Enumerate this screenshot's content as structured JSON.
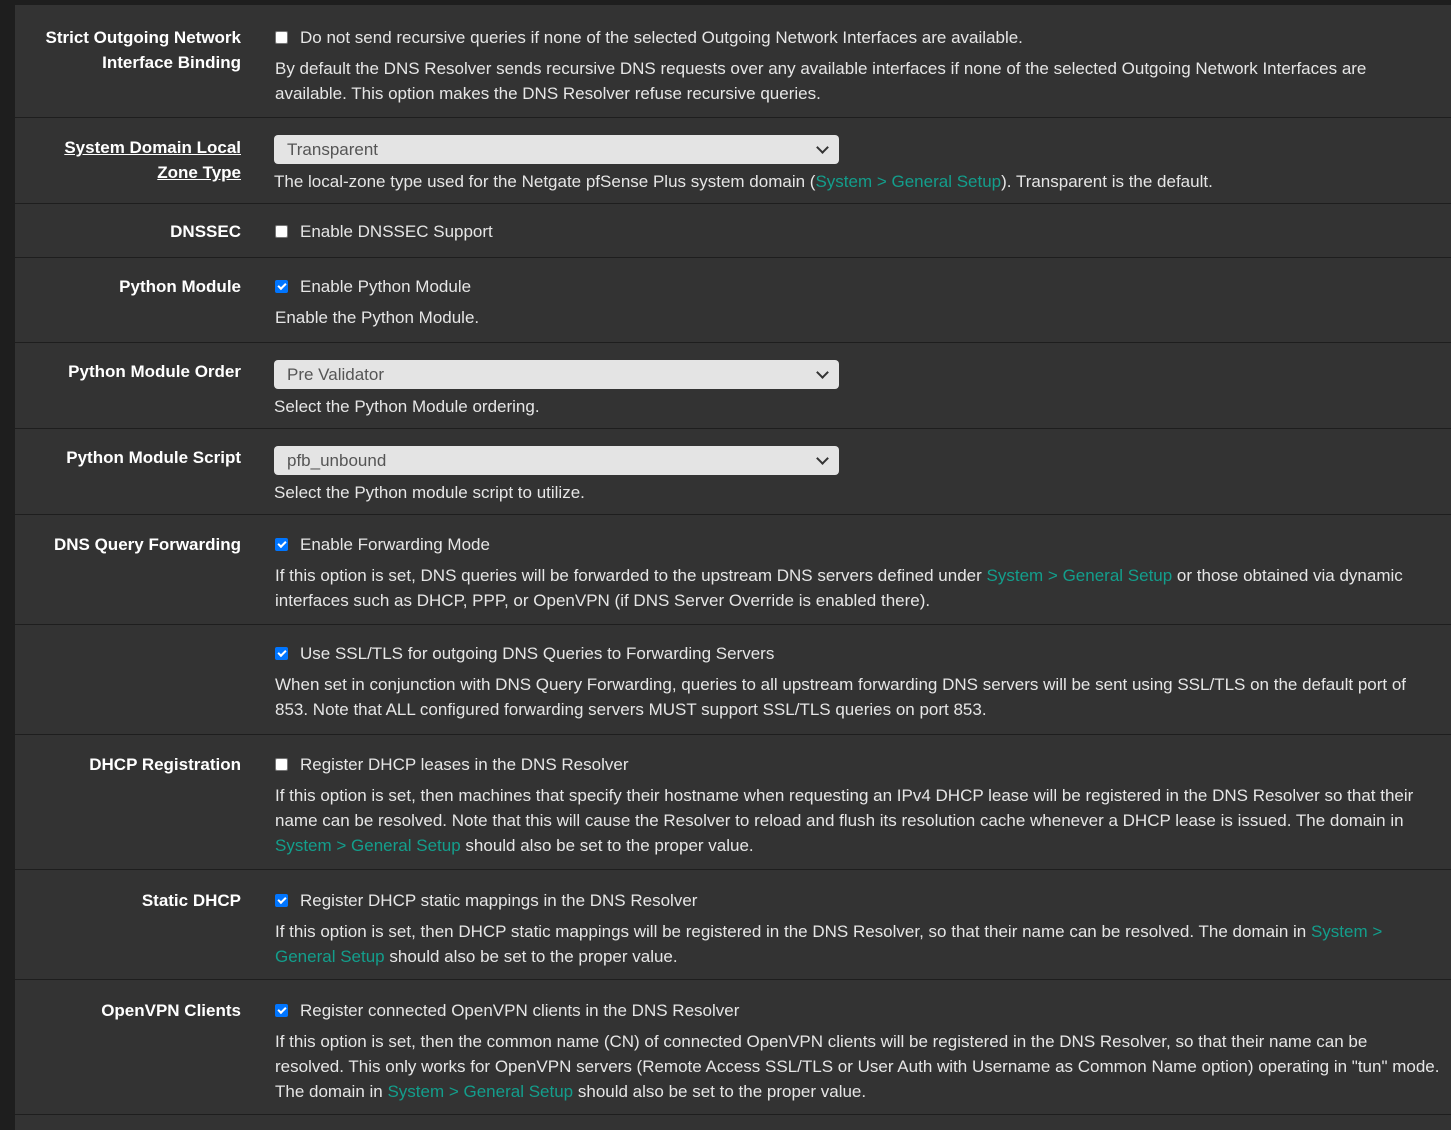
{
  "link_text": "System > General Setup",
  "rows": {
    "strict": {
      "label_line1": "Strict Outgoing Network",
      "label_line2": "Interface Binding",
      "checkbox_label": "Do not send recursive queries if none of the selected Outgoing Network Interfaces are available.",
      "checked": false,
      "desc": "By default the DNS Resolver sends recursive DNS requests over any available interfaces if none of the selected Outgoing Network Interfaces are available. This option makes the DNS Resolver refuse recursive queries."
    },
    "zone_type": {
      "label_line1": "System Domain Local",
      "label_line2": "Zone Type",
      "selected": "Transparent",
      "desc_before": "The local-zone type used for the Netgate pfSense Plus system domain (",
      "desc_after": "). Transparent is the default."
    },
    "dnssec": {
      "label": "DNSSEC",
      "checkbox_label": "Enable DNSSEC Support",
      "checked": false
    },
    "python_module": {
      "label": "Python Module",
      "checkbox_label": "Enable Python Module",
      "checked": true,
      "desc": "Enable the Python Module."
    },
    "python_order": {
      "label": "Python Module Order",
      "selected": "Pre Validator",
      "desc": "Select the Python Module ordering."
    },
    "python_script": {
      "label": "Python Module Script",
      "selected": "pfb_unbound",
      "desc": "Select the Python module script to utilize."
    },
    "forwarding": {
      "label": "DNS Query Forwarding",
      "checkbox_label": "Enable Forwarding Mode",
      "checked": true,
      "desc_before": "If this option is set, DNS queries will be forwarded to the upstream DNS servers defined under ",
      "desc_after": " or those obtained via dynamic interfaces such as DHCP, PPP, or OpenVPN (if DNS Server Override is enabled there)."
    },
    "ssl": {
      "checkbox_label": "Use SSL/TLS for outgoing DNS Queries to Forwarding Servers",
      "checked": true,
      "desc": "When set in conjunction with DNS Query Forwarding, queries to all upstream forwarding DNS servers will be sent using SSL/TLS on the default port of 853. Note that ALL configured forwarding servers MUST support SSL/TLS queries on port 853."
    },
    "dhcp_reg": {
      "label": "DHCP Registration",
      "checkbox_label": "Register DHCP leases in the DNS Resolver",
      "checked": false,
      "desc_before": "If this option is set, then machines that specify their hostname when requesting an IPv4 DHCP lease will be registered in the DNS Resolver so that their name can be resolved. Note that this will cause the Resolver to reload and flush its resolution cache whenever a DHCP lease is issued. The domain in ",
      "desc_after": " should also be set to the proper value."
    },
    "static_dhcp": {
      "label": "Static DHCP",
      "checkbox_label": "Register DHCP static mappings in the DNS Resolver",
      "checked": true,
      "desc_before": "If this option is set, then DHCP static mappings will be registered in the DNS Resolver, so that their name can be resolved. The domain in ",
      "desc_after": " should also be set to the proper value."
    },
    "openvpn": {
      "label": "OpenVPN Clients",
      "checkbox_label": "Register connected OpenVPN clients in the DNS Resolver",
      "checked": true,
      "desc_before": "If this option is set, then the common name (CN) of connected OpenVPN clients will be registered in the DNS Resolver, so that their name can be resolved. This only works for OpenVPN servers (Remote Access SSL/TLS or User Auth with Username as Common Name option) operating in \"tun\" mode. The domain in ",
      "desc_after": " should also be set to the proper value."
    }
  }
}
